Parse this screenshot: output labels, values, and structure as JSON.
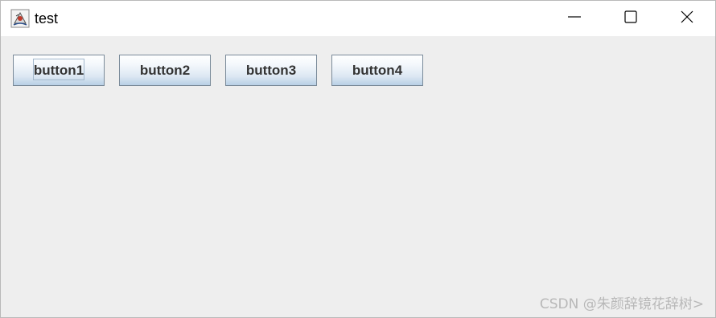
{
  "window": {
    "title": "test",
    "icons": {
      "app": "java-cup-icon",
      "minimize": "minimize-icon",
      "maximize": "maximize-icon",
      "close": "close-icon"
    }
  },
  "buttons": [
    {
      "label": "button1",
      "focused": true
    },
    {
      "label": "button2",
      "focused": false
    },
    {
      "label": "button3",
      "focused": false
    },
    {
      "label": "button4",
      "focused": false
    }
  ],
  "watermark": "CSDN @朱颜辞镜花辞树>",
  "colors": {
    "content_bg": "#eeeeee",
    "titlebar_bg": "#ffffff",
    "button_border": "#7a8a99",
    "button_text": "#333333"
  }
}
